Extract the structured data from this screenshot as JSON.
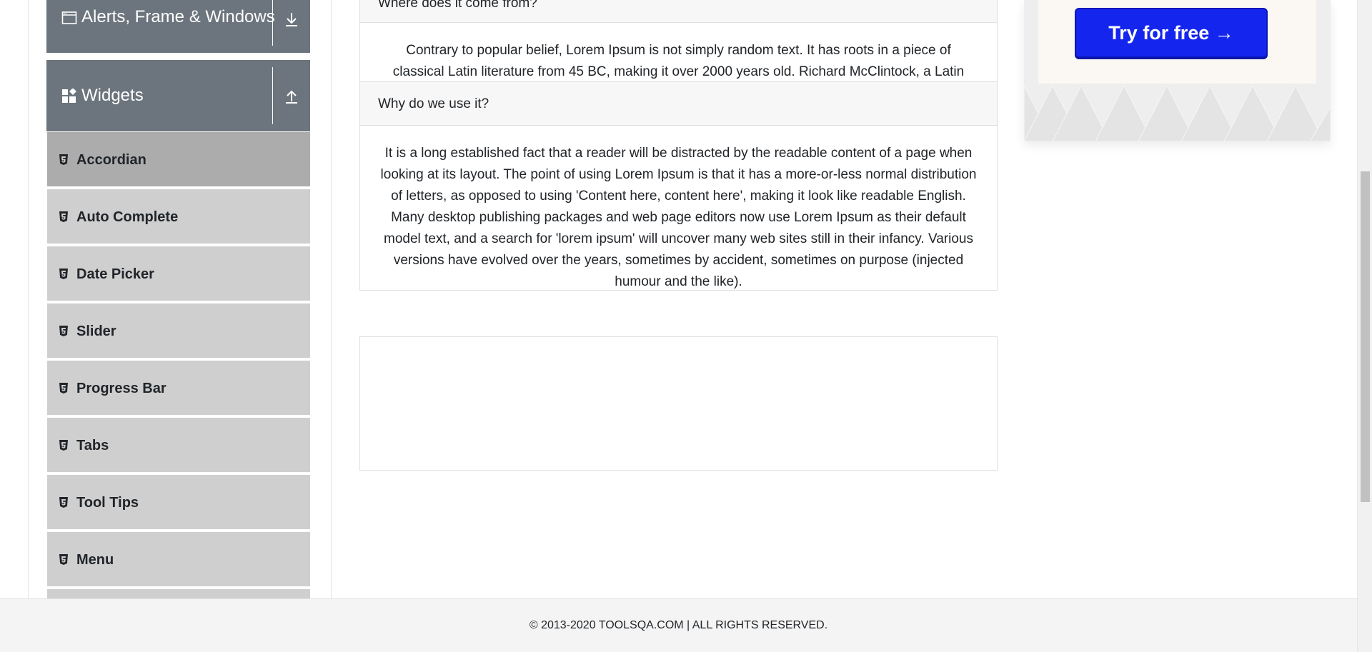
{
  "sidebar": {
    "groups": [
      {
        "title": "Alerts, Frame & Windows",
        "toggle_icon": "download-arrow-icon"
      },
      {
        "title": "Widgets",
        "toggle_icon": "upload-arrow-icon"
      }
    ],
    "items": [
      {
        "label": "Accordian",
        "active": true
      },
      {
        "label": "Auto Complete",
        "active": false
      },
      {
        "label": "Date Picker",
        "active": false
      },
      {
        "label": "Slider",
        "active": false
      },
      {
        "label": "Progress Bar",
        "active": false
      },
      {
        "label": "Tabs",
        "active": false
      },
      {
        "label": "Tool Tips",
        "active": false
      },
      {
        "label": "Menu",
        "active": false
      }
    ]
  },
  "accordion": {
    "sections": [
      {
        "header": "Where does it come from?",
        "body": "Contrary to popular belief, Lorem Ipsum is not simply random text. It has roots in a piece of classical Latin literature from 45 BC, making it over 2000 years old. Richard McClintock, a Latin"
      },
      {
        "header": "Why do we use it?",
        "body": "It is a long established fact that a reader will be distracted by the readable content of a page when looking at its layout. The point of using Lorem Ipsum is that it has a more-or-less normal distribution of letters, as opposed to using 'Content here, content here', making it look like readable English. Many desktop publishing packages and web page editors now use Lorem Ipsum as their default model text, and a search for 'lorem ipsum' will uncover many web sites still in their infancy. Various versions have evolved over the years, sometimes by accident, sometimes on purpose (injected humour and the like)."
      }
    ]
  },
  "ad": {
    "button_label": "Try for free →"
  },
  "footer": {
    "text": "© 2013-2020 TOOLSQA.COM | ALL RIGHTS RESERVED."
  },
  "colors": {
    "group_header_bg": "#6c757d",
    "menu_item_bg": "#cfcfcf",
    "menu_item_active_bg": "#acacac",
    "ad_button_bg": "#1426ee"
  }
}
